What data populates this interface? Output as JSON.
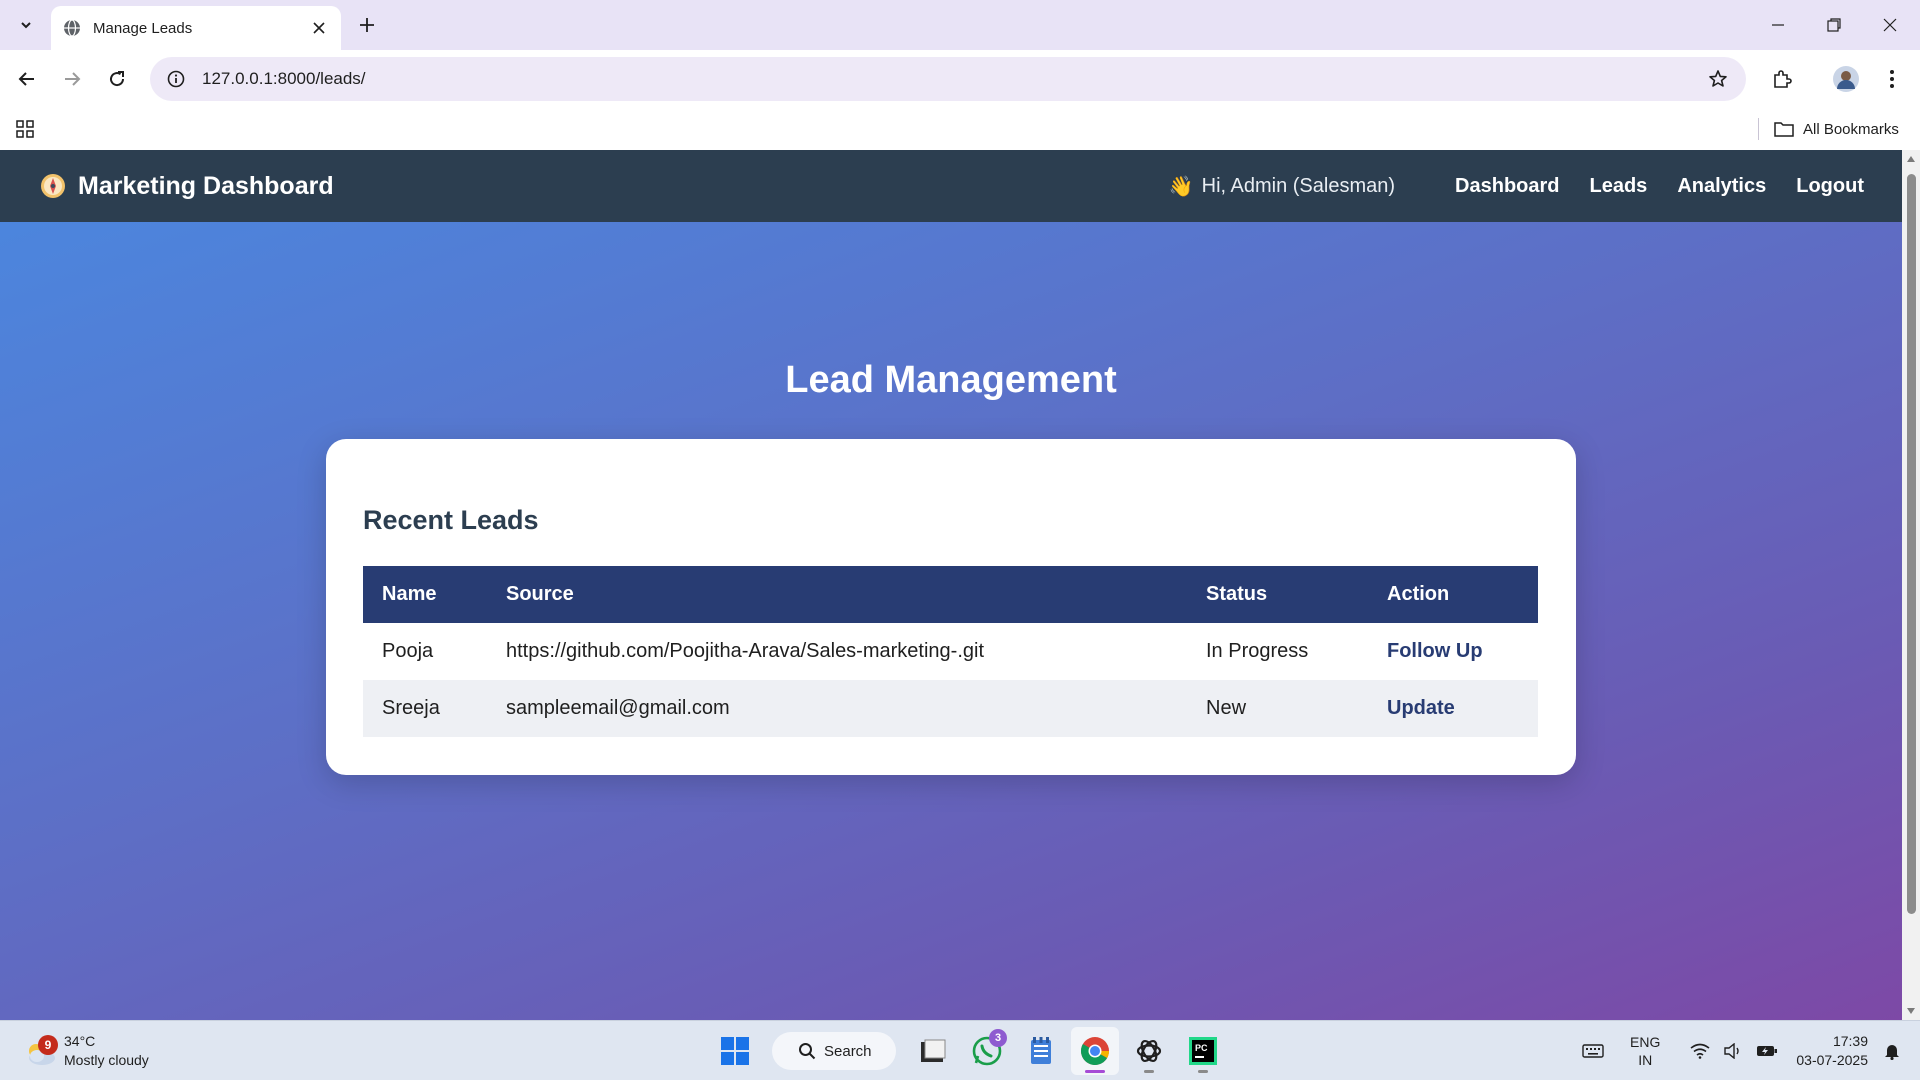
{
  "browser": {
    "tab_title": "Manage Leads",
    "url": "127.0.0.1:8000/leads/",
    "all_bookmarks_label": "All Bookmarks"
  },
  "app": {
    "brand": "Marketing Dashboard",
    "greeting": "Hi, Admin (Salesman)",
    "greeting_emoji": "👋",
    "nav": [
      "Dashboard",
      "Leads",
      "Analytics",
      "Logout"
    ],
    "page_title": "Lead Management",
    "section_title": "Recent Leads",
    "table": {
      "columns": [
        "Name",
        "Source",
        "Status",
        "Action"
      ],
      "rows": [
        {
          "name": "Pooja",
          "source": "https://github.com/Poojitha-Arava/Sales-marketing-.git",
          "status": "In Progress",
          "action": "Follow Up"
        },
        {
          "name": "Sreeja",
          "source": "sampleemail@gmail.com",
          "status": "New",
          "action": "Update"
        }
      ]
    },
    "colors": {
      "navbar": "#2c3e50",
      "table_header": "#283c73",
      "gradient_start": "#4a88e0",
      "gradient_end": "#7d49a6"
    }
  },
  "taskbar": {
    "weather_alert_count": "9",
    "temperature": "34°C",
    "weather_desc": "Mostly cloudy",
    "search_label": "Search",
    "whatsapp_badge": "3",
    "lang_line1": "ENG",
    "lang_line2": "IN",
    "time": "17:39",
    "date": "03-07-2025"
  },
  "icons": [
    "tab-search-icon",
    "globe-icon",
    "close-icon",
    "plus-icon",
    "minimize-icon",
    "restore-icon",
    "back-arrow-icon",
    "forward-arrow-icon",
    "reload-icon",
    "site-info-icon",
    "star-icon",
    "extensions-icon",
    "avatar",
    "more-vert-icon",
    "apps-grid-icon",
    "folder-icon",
    "compass-logo-icon",
    "waving-hand-icon",
    "windows-start-icon",
    "search-icon",
    "file-explorer-icon",
    "whatsapp-icon",
    "notepad-icon",
    "chrome-icon",
    "chatgpt-icon",
    "pycharm-icon",
    "keyboard-icon",
    "wifi-icon",
    "volume-icon",
    "battery-icon",
    "bell-icon"
  ]
}
